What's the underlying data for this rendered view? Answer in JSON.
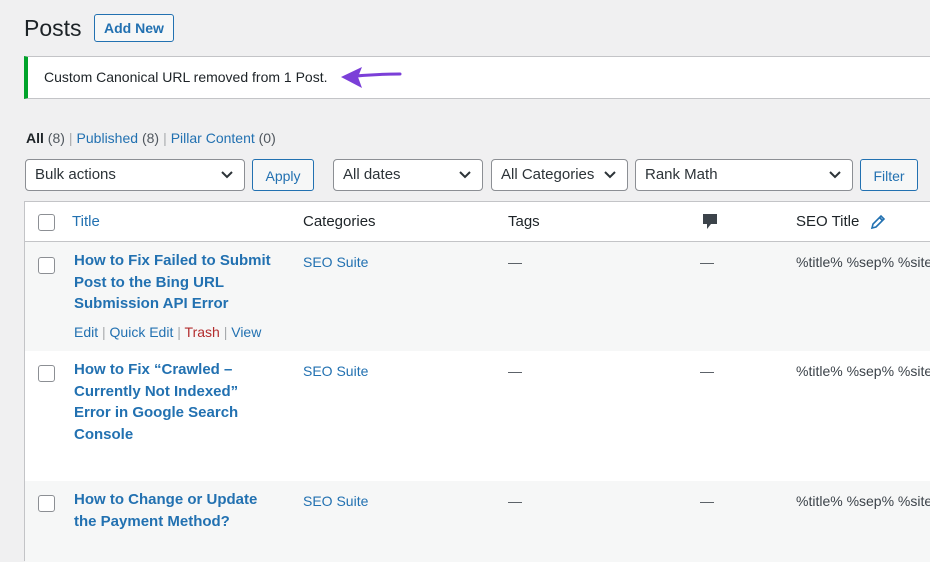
{
  "header": {
    "title": "Posts",
    "add_new_label": "Add New"
  },
  "notice": {
    "text": "Custom Canonical URL removed from 1 Post.",
    "border_color": "#00a32a",
    "arrow_color": "#7b3fd8"
  },
  "filters": {
    "all_label": "All",
    "all_count": "(8)",
    "published_label": "Published",
    "published_count": "(8)",
    "pillar_label": "Pillar Content",
    "pillar_count": "(0)"
  },
  "toolbar": {
    "bulk_actions": "Bulk actions",
    "apply_label": "Apply",
    "dates": "All dates",
    "categories": "All Categories",
    "seo_filter": "Rank Math",
    "filter_label": "Filter"
  },
  "table": {
    "columns": {
      "title": "Title",
      "categories": "Categories",
      "tags": "Tags",
      "seo_title": "SEO Title"
    },
    "rows": [
      {
        "title_lines": [
          "How to Fix Failed to Submit",
          "Post to the Bing URL",
          "Submission API Error"
        ],
        "category": "SEO Suite",
        "tags": "—",
        "comments": "—",
        "seo_title": "%title% %sep% %site",
        "actions": {
          "edit": "Edit",
          "quick_edit": "Quick Edit",
          "trash": "Trash",
          "view": "View",
          "sep": "|"
        }
      },
      {
        "title_lines": [
          "How to Fix “Crawled –",
          "Currently Not Indexed”",
          "Error in Google Search",
          "Console"
        ],
        "category": "SEO Suite",
        "tags": "—",
        "comments": "—",
        "seo_title": "%title% %sep% %site"
      },
      {
        "title_lines": [
          "How to Change or Update",
          "the Payment Method?"
        ],
        "category": "SEO Suite",
        "tags": "—",
        "comments": "—",
        "seo_title": "%title% %sep% %site"
      }
    ]
  }
}
